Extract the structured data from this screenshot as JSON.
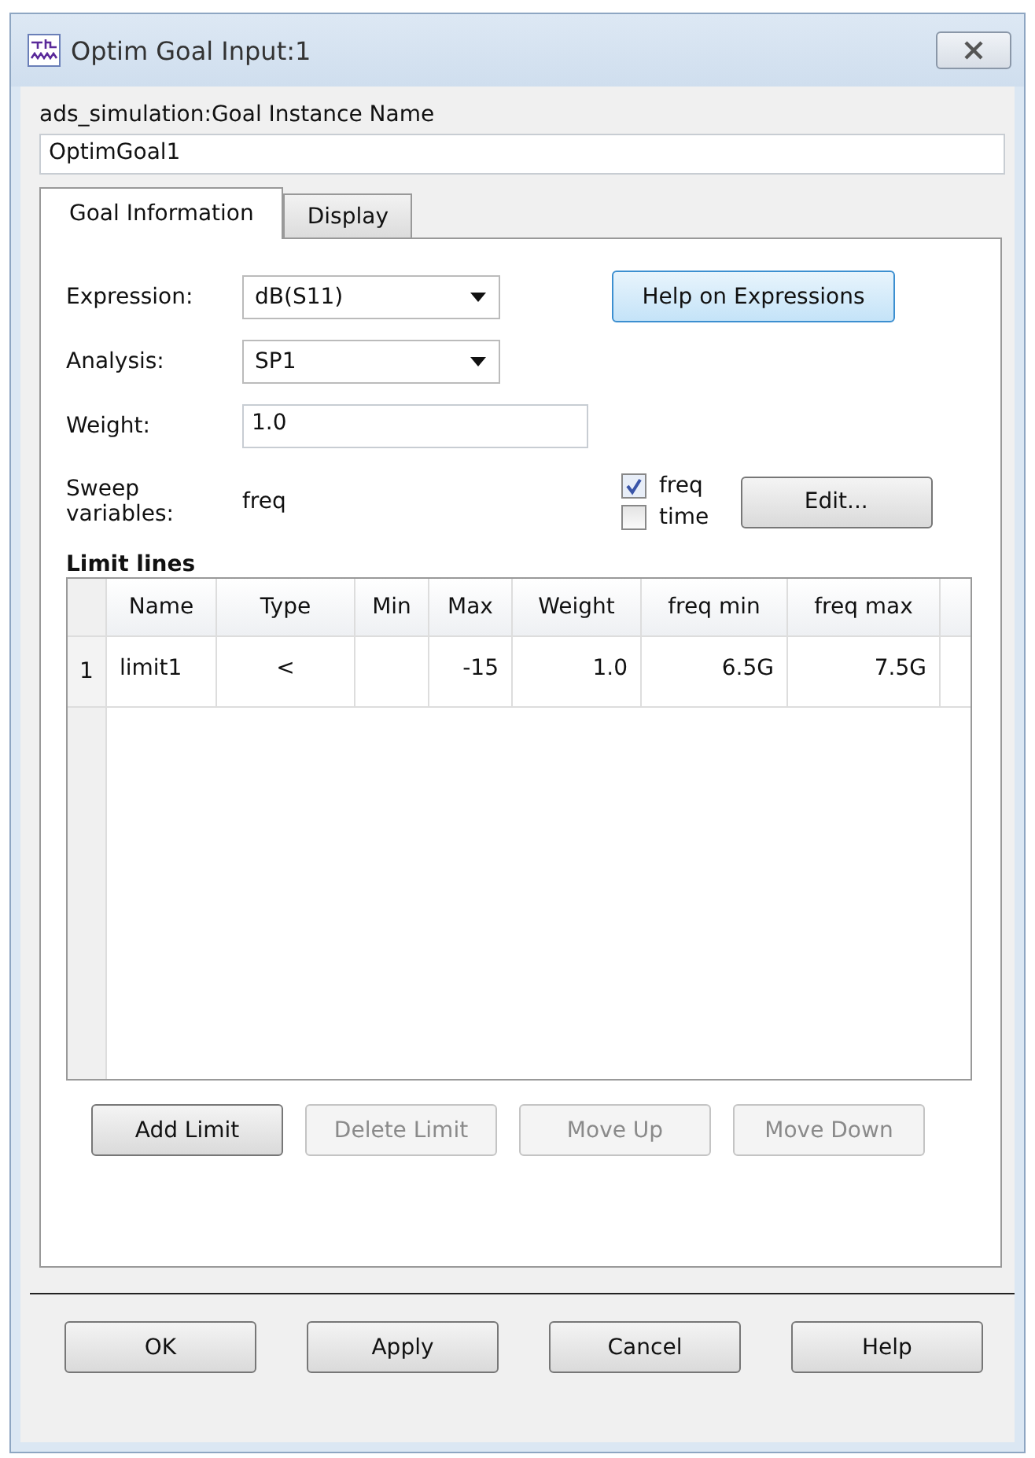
{
  "window": {
    "title": "Optim Goal Input:1"
  },
  "instance": {
    "label": "ads_simulation:Goal Instance Name",
    "value": "OptimGoal1"
  },
  "tabs": [
    {
      "label": "Goal Information",
      "selected": true
    },
    {
      "label": "Display",
      "selected": false
    }
  ],
  "expression": {
    "label": "Expression:",
    "value": "dB(S11)"
  },
  "analysis": {
    "label": "Analysis:",
    "value": "SP1"
  },
  "weight": {
    "label": "Weight:",
    "value": "1.0"
  },
  "help_button": "Help on Expressions",
  "sweep": {
    "label": "Sweep variables:",
    "value": "freq",
    "options": [
      {
        "label": "freq",
        "checked": true
      },
      {
        "label": "time",
        "checked": false
      }
    ],
    "edit_button": "Edit..."
  },
  "limit_lines": {
    "title": "Limit lines",
    "columns": [
      "Name",
      "Type",
      "Min",
      "Max",
      "Weight",
      "freq min",
      "freq max"
    ],
    "rows": [
      {
        "index": "1",
        "cells": [
          "limit1",
          "<",
          "",
          "-15",
          "1.0",
          "6.5G",
          "7.5G"
        ]
      }
    ]
  },
  "limit_buttons": [
    {
      "label": "Add Limit",
      "disabled": false
    },
    {
      "label": "Delete Limit",
      "disabled": true
    },
    {
      "label": "Move Up",
      "disabled": true
    },
    {
      "label": "Move Down",
      "disabled": true
    }
  ],
  "buttons": [
    "OK",
    "Apply",
    "Cancel",
    "Help"
  ]
}
